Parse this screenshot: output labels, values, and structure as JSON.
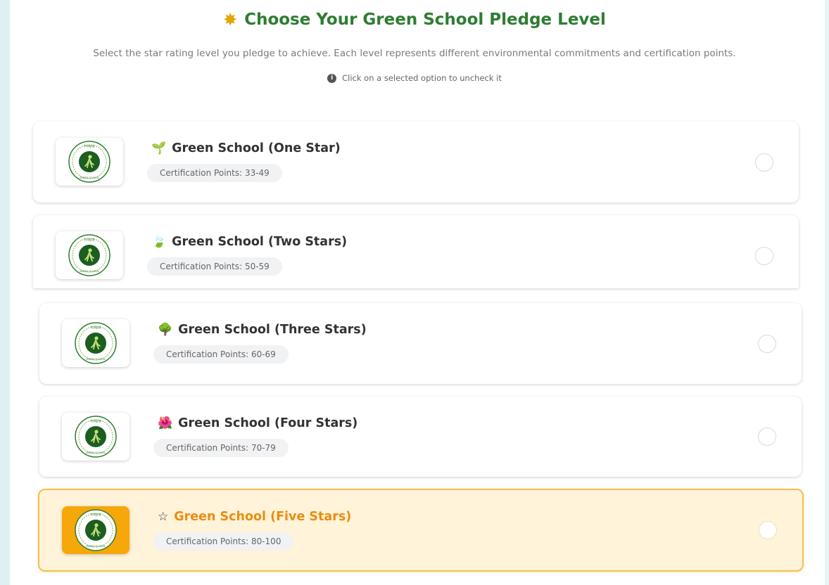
{
  "header": {
    "icon": "sparkle-icon",
    "title": "Choose Your Green School Pledge Level",
    "subtitle": "Select the star rating level you pledge to achieve. Each level represents different environmental commitments and certification points.",
    "hint": "Click on a selected option to uncheck it"
  },
  "badge_text": {
    "top": "PUNJAB",
    "bottom": "GREEN SCHOOL"
  },
  "levels": [
    {
      "icon": "seedling-icon",
      "glyph": "🌱",
      "title": "Green School (One Star)",
      "points": "Certification Points: 33-49",
      "selected": false
    },
    {
      "icon": "leaf-icon",
      "glyph": "🍃",
      "title": "Green School (Two Stars)",
      "points": "Certification Points: 50-59",
      "selected": false
    },
    {
      "icon": "tree-icon",
      "glyph": "🌳",
      "title": "Green School (Three Stars)",
      "points": "Certification Points: 60-69",
      "selected": false
    },
    {
      "icon": "flower-icon",
      "glyph": "🌺",
      "title": "Green School (Four Stars)",
      "points": "Certification Points: 70-79",
      "selected": false
    },
    {
      "icon": "star-icon",
      "glyph": "☆",
      "title": "Green School (Five Stars)",
      "points": "Certification Points: 80-100",
      "selected": true
    }
  ],
  "colors": {
    "title_green": "#2e7d32",
    "selected_title": "#ea8d12",
    "selected_bg": "#fff3d9",
    "selected_border": "#f2c14e"
  }
}
